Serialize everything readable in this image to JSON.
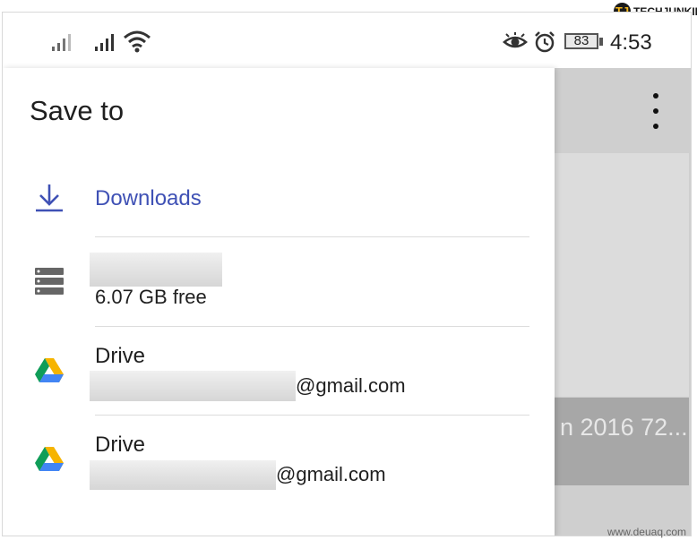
{
  "status_bar": {
    "battery": "83",
    "time": "4:53",
    "icons": [
      "signal-icon",
      "signal-icon",
      "wifi-icon",
      "eye-icon",
      "alarm-icon",
      "battery-icon"
    ]
  },
  "background_app": {
    "caption": "n 2016 72..."
  },
  "drawer": {
    "title": "Save to",
    "items": [
      {
        "icon": "download-icon",
        "label": "Downloads",
        "color": "#3f51b5"
      },
      {
        "icon": "storage-icon",
        "subtitle": "6.07 GB free"
      },
      {
        "icon": "google-drive-icon",
        "label": "Drive",
        "subtitle": "@gmail.com"
      },
      {
        "icon": "google-drive-icon",
        "label": "Drive",
        "subtitle": "@gmail.com"
      }
    ]
  },
  "watermarks": {
    "logo": "TECHJUNKIE",
    "footer": "www.deuaq.com"
  }
}
